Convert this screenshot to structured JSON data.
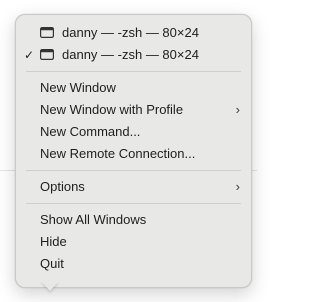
{
  "menu": {
    "windows": [
      {
        "label": "danny — -zsh — 80×24",
        "checked": false,
        "icon": "terminal-window-icon"
      },
      {
        "label": "danny — -zsh — 80×24",
        "checked": true,
        "check_mark": "✓",
        "icon": "terminal-window-icon"
      }
    ],
    "actions": [
      {
        "label": "New Window",
        "submenu": false
      },
      {
        "label": "New Window with Profile",
        "submenu": true
      },
      {
        "label": "New Command...",
        "submenu": false
      },
      {
        "label": "New Remote Connection...",
        "submenu": false
      }
    ],
    "options": {
      "label": "Options",
      "submenu": true
    },
    "app": [
      {
        "label": "Show All Windows"
      },
      {
        "label": "Hide"
      },
      {
        "label": "Quit"
      }
    ],
    "chevron_glyph": "›"
  }
}
